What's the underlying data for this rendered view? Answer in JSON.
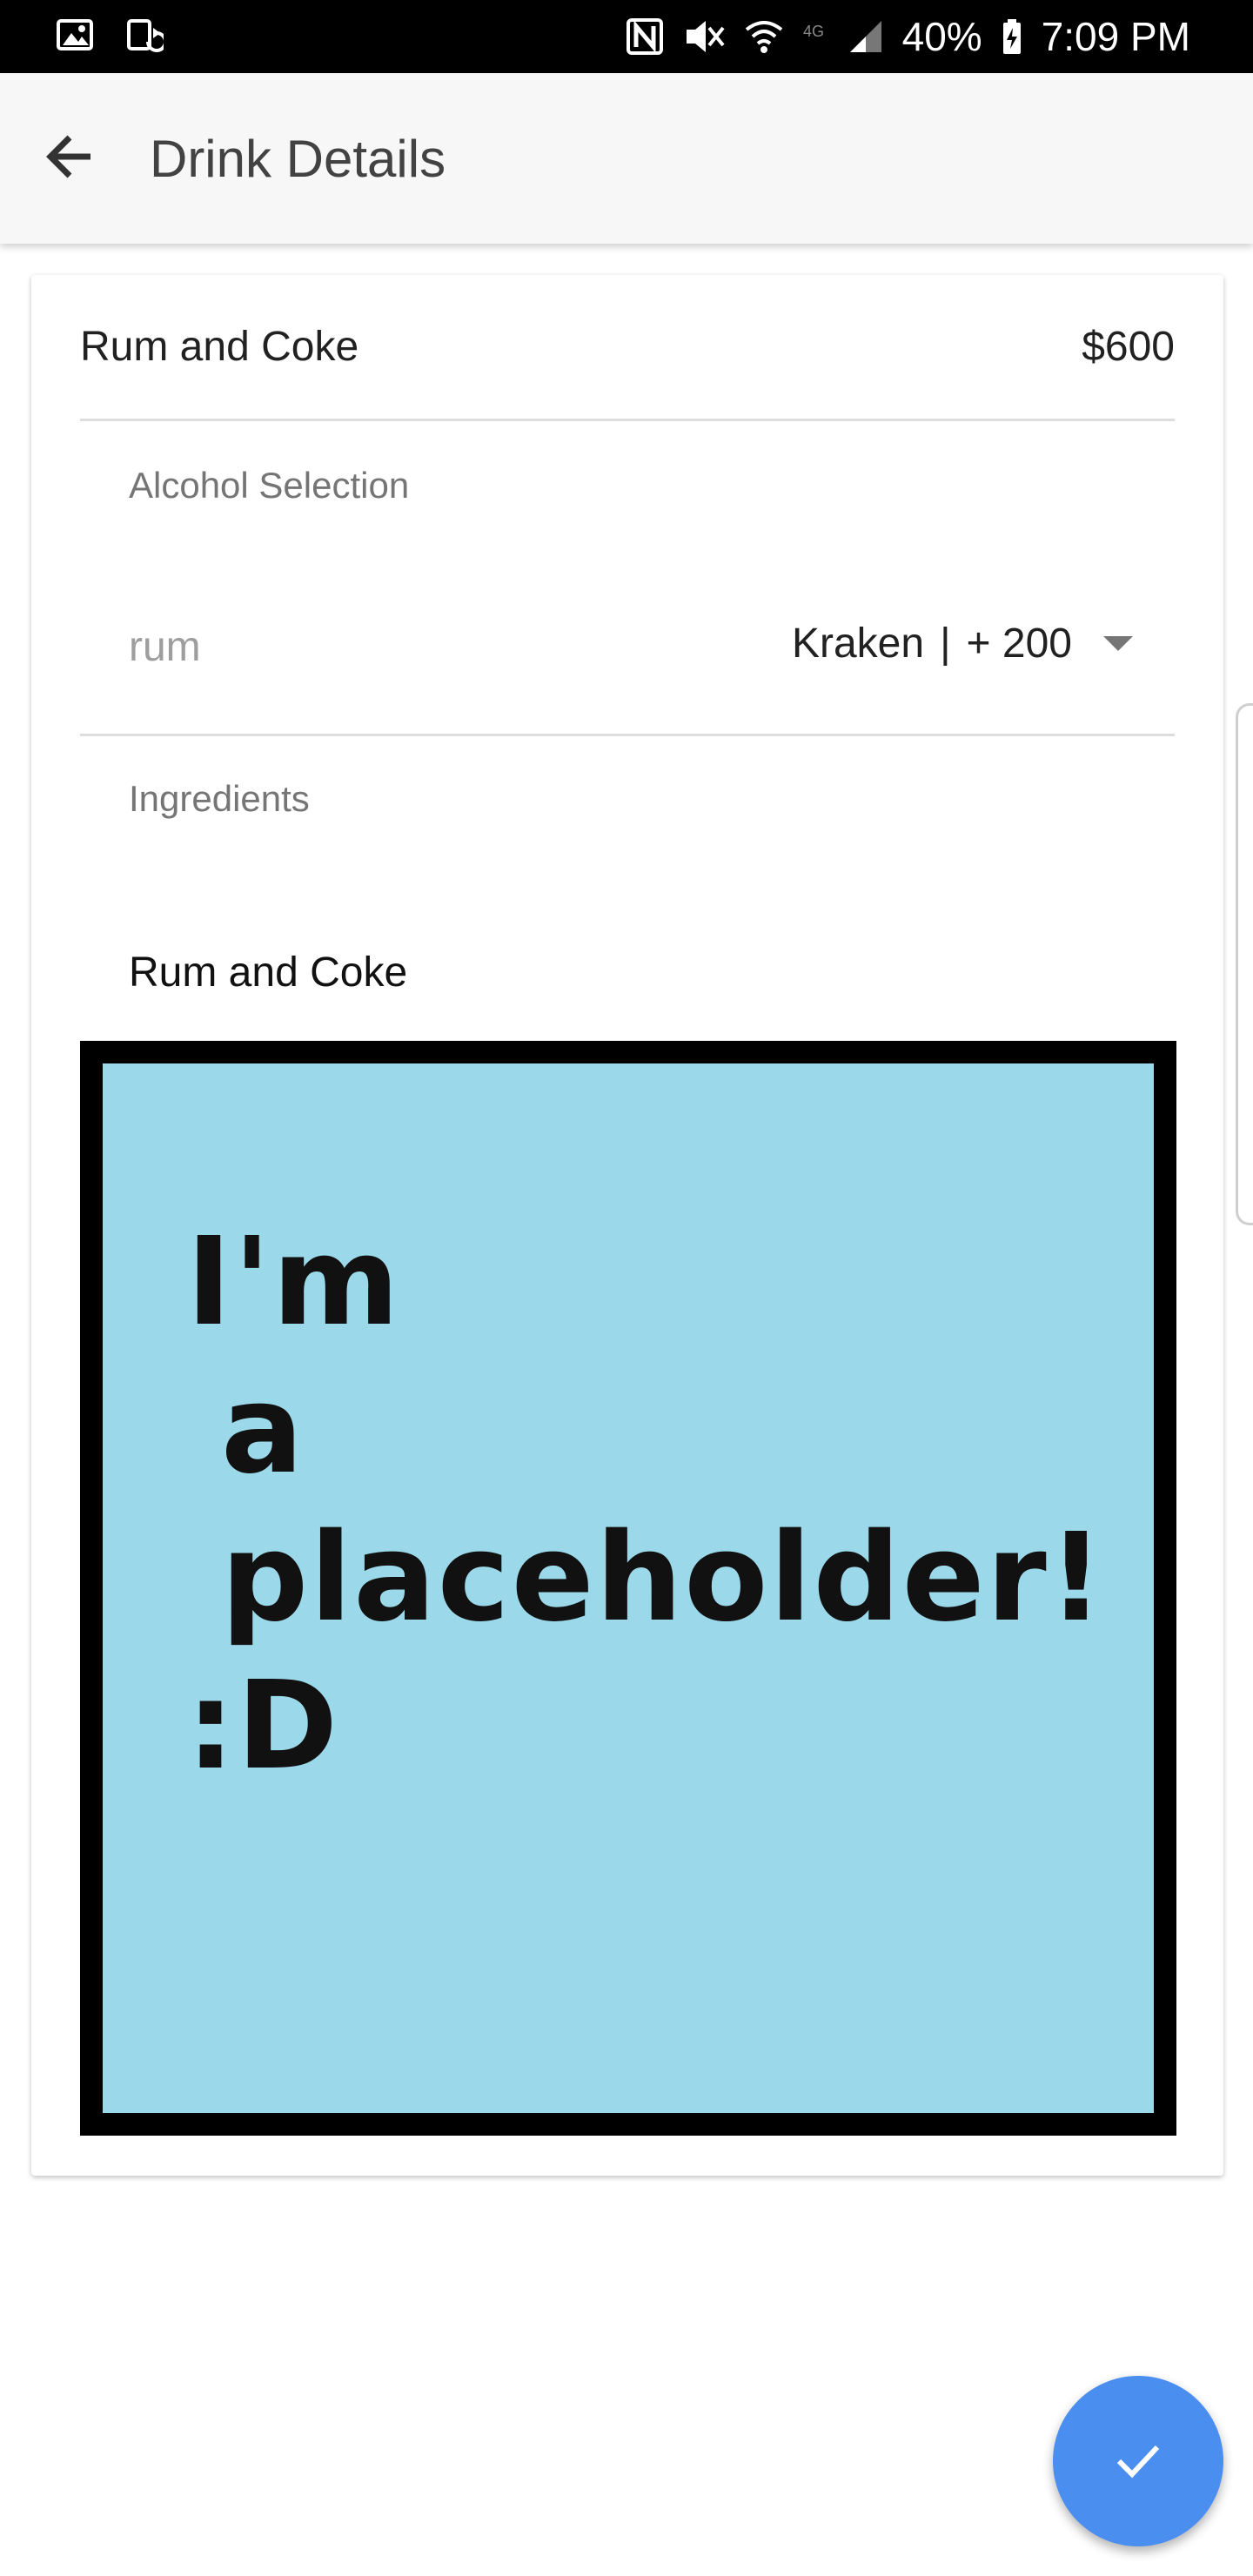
{
  "status_bar": {
    "battery": "40%",
    "time": "7:09 PM",
    "icons_left": [
      "gallery-icon",
      "screen-rotate-icon"
    ],
    "icons_right": [
      "nfc-icon",
      "vibrate-mute-icon",
      "wifi-icon",
      "lte-icon",
      "signal-icon",
      "battery-charging-icon"
    ]
  },
  "app_bar": {
    "title": "Drink Details",
    "back_icon": "arrow-back-icon"
  },
  "drink": {
    "name": "Rum and Coke",
    "price": "$600",
    "alcohol_selection_label": "Alcohol Selection",
    "alcohol_type": "rum",
    "alcohol_choice": "Kraken",
    "separator": "|",
    "alcohol_upcharge": "+ 200",
    "ingredients_label": "Ingredients",
    "ingredients": "Rum and Coke"
  },
  "image_placeholder": {
    "line1": "I'm",
    "line2": "a",
    "line3": "placeholder!",
    "line4": ":D",
    "background": "#9bd9ea",
    "border": "#000000"
  },
  "fab": {
    "icon": "check-icon",
    "color": "#4a8ef0"
  }
}
